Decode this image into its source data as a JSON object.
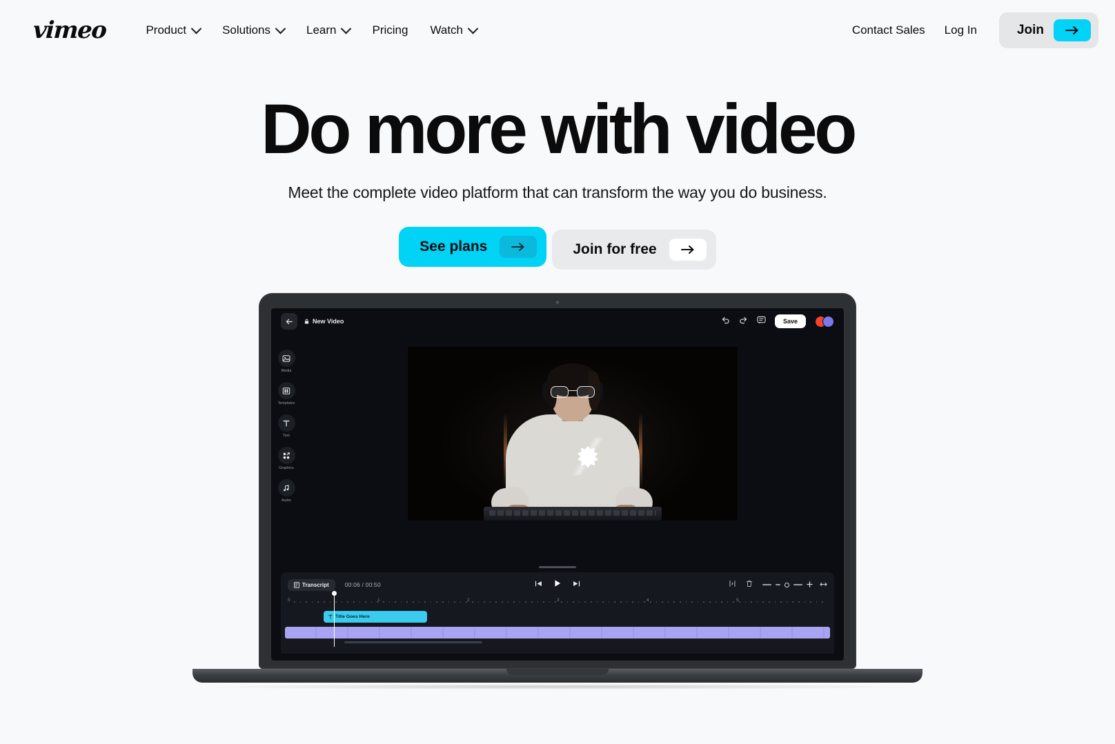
{
  "brand": {
    "logo_text": "vimeo",
    "accent": "#00D3F6",
    "surface": "#F8F9FA"
  },
  "header": {
    "nav": [
      {
        "label": "Product",
        "has_caret": true
      },
      {
        "label": "Solutions",
        "has_caret": true
      },
      {
        "label": "Learn",
        "has_caret": true
      },
      {
        "label": "Pricing",
        "has_caret": false
      },
      {
        "label": "Watch",
        "has_caret": true
      }
    ],
    "contact_sales": "Contact Sales",
    "log_in": "Log In",
    "join": "Join"
  },
  "hero": {
    "heading": "Do more with video",
    "subheading": "Meet the complete video platform that can transform the way you do business.",
    "primary_cta": "See plans",
    "secondary_cta": "Join for free"
  },
  "editor": {
    "doc_title": "New Video",
    "lock_icon": "lock-icon",
    "back_icon": "arrow-left-icon",
    "undo_icon": "undo-icon",
    "redo_icon": "redo-icon",
    "comment_icon": "comment-icon",
    "save_label": "Save",
    "avatars": [
      {
        "name": "avatar-1",
        "color": "#F2452E"
      },
      {
        "name": "avatar-2",
        "color": "#7B79E8"
      }
    ],
    "rail": [
      {
        "label": "Media",
        "icon": "image-icon"
      },
      {
        "label": "Templates",
        "icon": "layout-icon"
      },
      {
        "label": "Text",
        "icon": "text-icon"
      },
      {
        "label": "Graphics",
        "icon": "shapes-icon"
      },
      {
        "label": "Audio",
        "icon": "music-note-icon"
      }
    ],
    "timeline": {
      "transcript_label": "Transcript",
      "timecode": "00:06 / 00:50",
      "playback": [
        "skip-back-icon",
        "play-icon",
        "skip-forward-icon"
      ],
      "tools": [
        "split-icon",
        "trash-icon"
      ],
      "zoom": {
        "minus": "−",
        "plus": "+",
        "fit_icon": "fit-icon"
      },
      "ruler_ticks": [
        "0",
        "1",
        "2",
        "3",
        "4",
        "5"
      ],
      "clips": [
        {
          "name": "title-clip",
          "label": "Title Goes Here",
          "icon": "text-icon",
          "color": "#3ACBEF"
        },
        {
          "name": "video-clip",
          "label": "",
          "color": "#A9A4F2"
        }
      ]
    }
  }
}
